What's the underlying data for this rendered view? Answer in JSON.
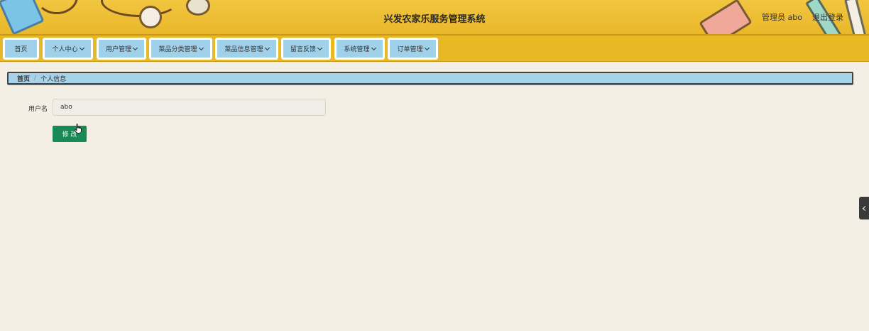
{
  "header": {
    "title": "兴发农家乐服务管理系统",
    "user_label": "管理员 abo",
    "logout_label": "退出登录"
  },
  "nav": {
    "items": [
      {
        "label": "首页",
        "has_dropdown": false
      },
      {
        "label": "个人中心",
        "has_dropdown": true
      },
      {
        "label": "用户管理",
        "has_dropdown": true
      },
      {
        "label": "菜品分类管理",
        "has_dropdown": true
      },
      {
        "label": "菜品信息管理",
        "has_dropdown": true
      },
      {
        "label": "留言反馈",
        "has_dropdown": true
      },
      {
        "label": "系统管理",
        "has_dropdown": true
      },
      {
        "label": "订单管理",
        "has_dropdown": true
      }
    ]
  },
  "breadcrumb": {
    "home": "首页",
    "separator": "/",
    "current": "个人信息"
  },
  "form": {
    "username_label": "用户名",
    "username_value": "abo",
    "submit_label": "修 改"
  },
  "icons": {
    "side_toggle": "chevron-left-icon",
    "nav_dropdown": "chevron-down-icon",
    "cursor": "hand-pointer-icon"
  },
  "colors": {
    "header_bg": "#f2c640",
    "nav_bg": "#e7b924",
    "nav_item_bg": "#9fd1ea",
    "breadcrumb_bg": "#a7d3ea",
    "primary_button": "#1a8a55",
    "page_bg": "#f3efe4"
  }
}
